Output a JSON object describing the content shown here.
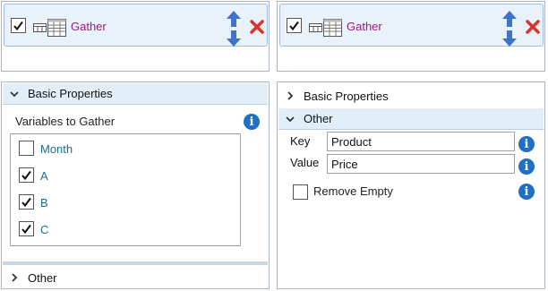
{
  "left_panel": {
    "step": {
      "enabled": true,
      "label": "Gather"
    },
    "sections": {
      "basic": {
        "title": "Basic Properties",
        "expanded": true
      },
      "other": {
        "title": "Other",
        "expanded": false
      }
    },
    "variables_label": "Variables to Gather",
    "variables": [
      {
        "label": "Month",
        "checked": false
      },
      {
        "label": "A",
        "checked": true
      },
      {
        "label": "B",
        "checked": true
      },
      {
        "label": "C",
        "checked": true
      }
    ]
  },
  "right_panel": {
    "step": {
      "enabled": true,
      "label": "Gather"
    },
    "sections": {
      "basic": {
        "title": "Basic Properties",
        "expanded": false
      },
      "other": {
        "title": "Other",
        "expanded": true
      }
    },
    "key": {
      "label": "Key",
      "value": "Product"
    },
    "value": {
      "label": "Value",
      "value": "Price"
    },
    "remove_empty": {
      "label": "Remove Empty",
      "checked": false
    }
  },
  "colors": {
    "step_label": "#a0177a",
    "variable_label": "#1c6d8c",
    "section_header_bg": "#e1eef8",
    "info_icon": "#1f6fc5",
    "delete_icon": "#d9342b",
    "move_arrows": "#3d74c9"
  },
  "icons": {
    "step": "table-gather-icon",
    "move_up": "arrow-up-icon",
    "move_down": "arrow-down-icon",
    "delete": "red-x-icon",
    "info": "info-icon",
    "section_expanded": "chevron-down-icon",
    "section_collapsed": "chevron-right-icon"
  }
}
